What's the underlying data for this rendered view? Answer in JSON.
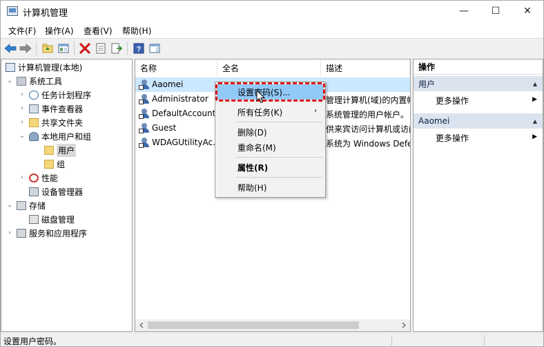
{
  "window": {
    "title": "计算机管理",
    "controls": {
      "minimize": "—",
      "maximize": "☐",
      "close": "✕"
    }
  },
  "menubar": {
    "items": [
      {
        "label": "文件(F)"
      },
      {
        "label": "操作(A)"
      },
      {
        "label": "查看(V)"
      },
      {
        "label": "帮助(H)"
      }
    ]
  },
  "toolbar": {
    "icons": [
      "back-icon",
      "forward-icon",
      "up-folder-icon",
      "show-hide-tree-icon",
      "delete-icon",
      "properties-icon",
      "export-list-icon",
      "help-icon",
      "show-action-pane-icon"
    ]
  },
  "tree": {
    "items": [
      {
        "label": "计算机管理(本地)",
        "icon": "computer-icon",
        "expanded": true
      },
      {
        "label": "系统工具",
        "icon": "tools-icon",
        "expanded": true
      },
      {
        "label": "任务计划程序",
        "icon": "task-scheduler-icon",
        "expanded": false
      },
      {
        "label": "事件查看器",
        "icon": "event-viewer-icon",
        "expanded": false
      },
      {
        "label": "共享文件夹",
        "icon": "shared-folder-icon",
        "expanded": false
      },
      {
        "label": "本地用户和组",
        "icon": "local-users-icon",
        "expanded": true
      },
      {
        "label": "用户",
        "icon": "folder-icon",
        "selected": true
      },
      {
        "label": "组",
        "icon": "folder-icon"
      },
      {
        "label": "性能",
        "icon": "performance-icon",
        "expanded": false
      },
      {
        "label": "设备管理器",
        "icon": "device-manager-icon"
      },
      {
        "label": "存储",
        "icon": "storage-icon",
        "expanded": true
      },
      {
        "label": "磁盘管理",
        "icon": "disk-management-icon"
      },
      {
        "label": "服务和应用程序",
        "icon": "services-icon",
        "expanded": false
      }
    ]
  },
  "list": {
    "columns": [
      "名称",
      "全名",
      "描述"
    ],
    "rows": [
      {
        "name": "Aaomei",
        "fullname": "",
        "description": "",
        "selected": true
      },
      {
        "name": "Administrator",
        "fullname": "",
        "description": "管理计算机(域)的内置帐户"
      },
      {
        "name": "DefaultAccount",
        "fullname": "",
        "description": "系统管理的用户帐户。"
      },
      {
        "name": "Guest",
        "fullname": "",
        "description": "供来宾访问计算机或访问域的内置帐户"
      },
      {
        "name": "WDAGUtilityAc...",
        "fullname": "",
        "description": "系统为 Windows Defender 应用程序防护方案管理和使用的用户帐户。"
      }
    ]
  },
  "context_menu": {
    "items": [
      {
        "label": "设置密码(S)...",
        "highlighted": true
      },
      {
        "label": "所有任务(K)",
        "submenu": true
      },
      {
        "label": "删除(D)"
      },
      {
        "label": "重命名(M)"
      },
      {
        "label": "属性(R)",
        "bold": true
      },
      {
        "label": "帮助(H)"
      }
    ],
    "submenu_arrow": "›"
  },
  "actions": {
    "title": "操作",
    "sections": [
      {
        "header": "用户",
        "items": [
          {
            "label": "更多操作"
          }
        ]
      },
      {
        "header": "Aaomei",
        "items": [
          {
            "label": "更多操作"
          }
        ]
      }
    ],
    "collapse_glyph": "▲",
    "more_glyph": "▶"
  },
  "status": {
    "text": "设置用户密码。"
  },
  "colors": {
    "selection": "#cce8ff",
    "menu_highlight": "#91c9f7",
    "annotation_red": "#e01010",
    "section_header": "#dbe3ee"
  }
}
